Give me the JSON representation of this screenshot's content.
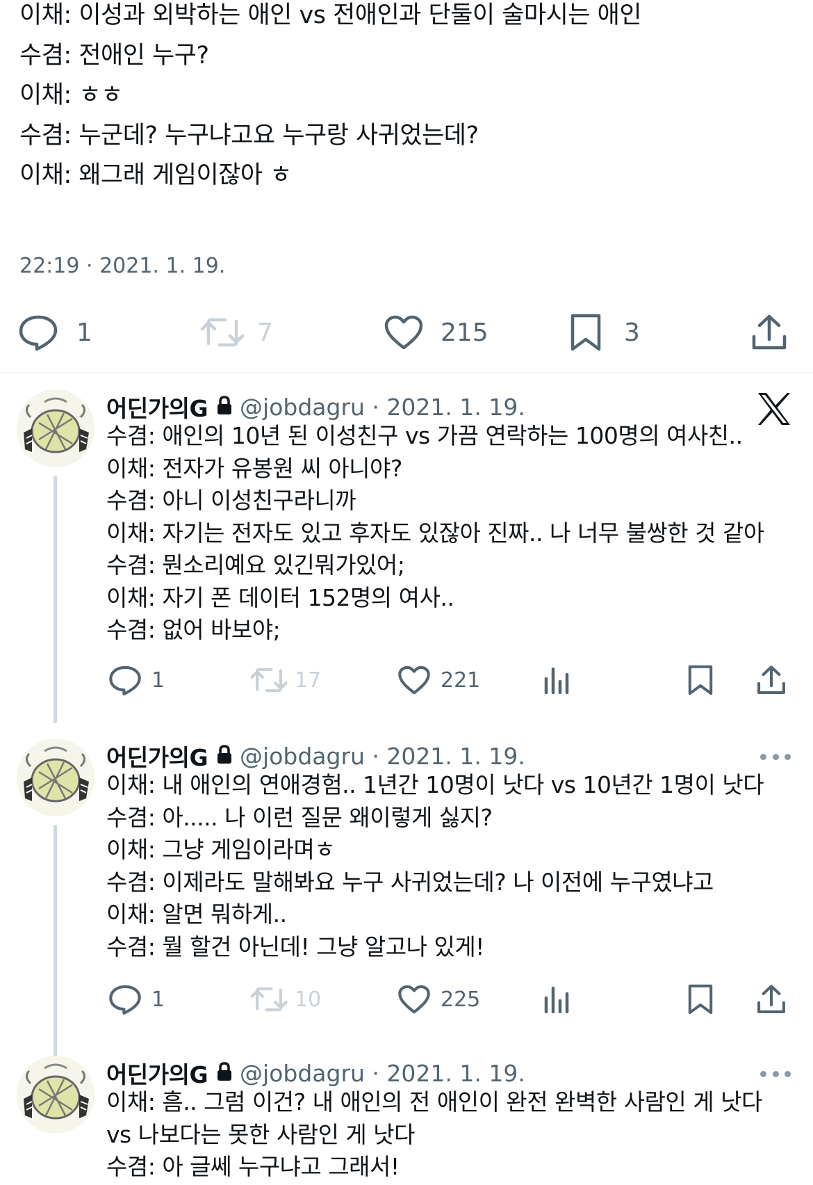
{
  "main_tweet": {
    "lines": [
      "이채: 이성과 외박하는 애인 vs 전애인과 단둘이 술마시는 애인",
      "수겸: 전애인 누구?",
      "이채: ㅎㅎ",
      "수겸: 누군데? 누구냐고요 누구랑 사귀었는데?",
      "이채: 왜그래 게임이잖아 ㅎ"
    ],
    "timestamp": "22:19 · 2021. 1. 19.",
    "actions": {
      "replies": "1",
      "retweets": "7",
      "likes": "215",
      "bookmarks": "3"
    }
  },
  "replies": [
    {
      "name": "어딘가의G",
      "handle": "@jobdagru · 2021. 1. 19.",
      "lines": [
        "수겸: 애인의 10년 된 이성친구 vs 가끔 연락하는 100명의 여사친..",
        "이채: 전자가 유봉원 씨 아니야?",
        "수겸: 아니 이성친구라니까",
        "이채: 자기는 전자도 있고 후자도 있잖아 진짜.. 나 너무 불쌍한 것 같아",
        "수겸: 뭔소리예요 있긴뭐가있어;",
        "이채: 자기 폰 데이터 152명의 여사..",
        "수겸: 없어 바보야;"
      ],
      "actions": {
        "replies": "1",
        "retweets": "17",
        "likes": "221"
      }
    },
    {
      "name": "어딘가의G",
      "handle": "@jobdagru · 2021. 1. 19.",
      "lines": [
        "이채: 내 애인의 연애경험.. 1년간 10명이 낫다 vs 10년간 1명이 낫다",
        "수겸: 아..... 나 이런 질문 왜이렇게 싫지?",
        "이채: 그냥 게임이라며ㅎ",
        "수겸: 이제라도 말해봐요 누구 사귀었는데? 나 이전에 누구였냐고",
        "이채: 알면 뭐하게..",
        "수겸: 뭘 할건 아닌데! 그냥 알고나 있게!"
      ],
      "actions": {
        "replies": "1",
        "retweets": "10",
        "likes": "225"
      }
    },
    {
      "name": "어딘가의G",
      "handle": "@jobdagru · 2021. 1. 19.",
      "lines": [
        "이채: 흠.. 그럼 이건? 내 애인의 전 애인이 완전 완벽한 사람인 게 낫다",
        "vs 나보다는 못한 사람인 게 낫다",
        "수겸: 아 글쎄 누구냐고 그래서!"
      ]
    }
  ],
  "icons": {
    "reply": "reply-bubble-icon",
    "retweet": "retweet-icon",
    "like": "heart-icon",
    "bookmark": "bookmark-icon",
    "share": "share-icon",
    "views": "views-bar-chart-icon",
    "lock": "lock-icon",
    "more": "more-dots-icon",
    "brand": "x-logo-icon"
  },
  "colors": {
    "text": "#0f1419",
    "secondary": "#536471",
    "disabled": "#c9d1d8",
    "thread_line": "#cfd9de",
    "divider": "#eff3f4"
  }
}
